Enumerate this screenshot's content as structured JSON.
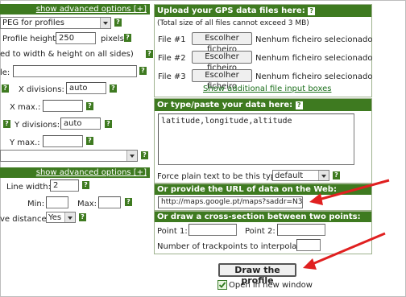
{
  "left": {
    "bar1_label": "show advanced options [+]",
    "format_select": "PEG for profiles",
    "profile_height_label": "Profile height:",
    "profile_height_value": "250",
    "profile_height_unit": "pixels",
    "width_height_note": "ed to width & height on all sides)",
    "field_label_e": "le:",
    "x_divisions_label": "X divisions:",
    "x_divisions_value": "auto",
    "x_max_label": "X max.:",
    "y_divisions_label": "Y divisions:",
    "y_divisions_value": "auto",
    "y_max_label": "Y max.:",
    "bar2_label": "show advanced options [+]",
    "line_width_label": "Line width:",
    "line_width_value": "2",
    "min_label": "Min:",
    "max_label": "Max:",
    "distance_label": "ve distance:",
    "distance_value": "Yes"
  },
  "upload": {
    "header": "Upload your GPS data files here:",
    "note": "(Total size of all files cannot exceed 3 MB)",
    "files": [
      {
        "label": "File #1",
        "button": "Escolher ficheiro",
        "status": "Nenhum ficheiro selecionado"
      },
      {
        "label": "File #2",
        "button": "Escolher ficheiro",
        "status": "Nenhum ficheiro selecionado"
      },
      {
        "label": "File #3",
        "button": "Escolher ficheiro",
        "status": "Nenhum ficheiro selecionado"
      }
    ],
    "more_link": "Show additional file input boxes"
  },
  "paste": {
    "header": "Or type/paste your data here:",
    "textarea_value": "latitude,longitude,altitude",
    "force_label": "Force plain text to be this type:",
    "force_value": "default"
  },
  "url": {
    "header": "Or provide the URL of data on the Web:",
    "value": "http://maps.google.pt/maps?saddr=N3"
  },
  "cross": {
    "header": "Or draw a cross-section between two points:",
    "point1_label": "Point 1:",
    "point2_label": "Point 2:",
    "trackpoints_label": "Number of trackpoints to interpolate:"
  },
  "actions": {
    "draw_button": "Draw the profile",
    "new_window_label": "Open in new window",
    "new_window_checked": true
  },
  "help_glyph": "?",
  "colors": {
    "header_green": "#3e7a20",
    "annotation_red": "#e02020",
    "link_green": "#1a6e1a"
  }
}
